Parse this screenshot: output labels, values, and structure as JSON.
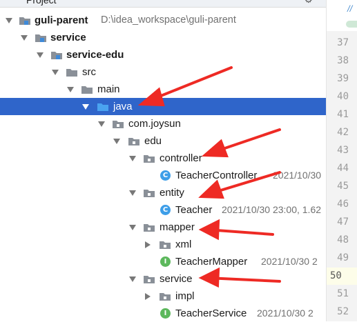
{
  "header": {
    "title": "Project"
  },
  "tree": {
    "rows": [
      {
        "name": "guli-parent",
        "path": "D:\\idea_workspace\\guli-parent"
      },
      {
        "name": "service"
      },
      {
        "name": "service-edu"
      },
      {
        "name": "src"
      },
      {
        "name": "main"
      },
      {
        "name": "java"
      },
      {
        "name": "com.joysun"
      },
      {
        "name": "edu"
      },
      {
        "name": "controller"
      },
      {
        "name": "TeacherController",
        "meta": "2021/10/30"
      },
      {
        "name": "entity"
      },
      {
        "name": "Teacher",
        "meta": "2021/10/30 23:00, 1.62"
      },
      {
        "name": "mapper"
      },
      {
        "name": "xml"
      },
      {
        "name": "TeacherMapper",
        "meta": "2021/10/30 2"
      },
      {
        "name": "service"
      },
      {
        "name": "impl"
      },
      {
        "name": "TeacherService",
        "meta": "2021/10/30 2"
      }
    ],
    "badges": {
      "class": "C",
      "interface": "I"
    }
  },
  "gutter": {
    "line_numbers": [
      "37",
      "38",
      "39",
      "40",
      "41",
      "42",
      "43",
      "44",
      "45",
      "46",
      "47",
      "48",
      "49",
      "50",
      "51",
      "52"
    ],
    "current_line": "50"
  },
  "colors": {
    "selection": "#2f65ca",
    "folder": "#8a9098",
    "source_folder": "#4a90d9",
    "module": "#3f8ad8",
    "annotation_arrow": "#ee2a24"
  }
}
